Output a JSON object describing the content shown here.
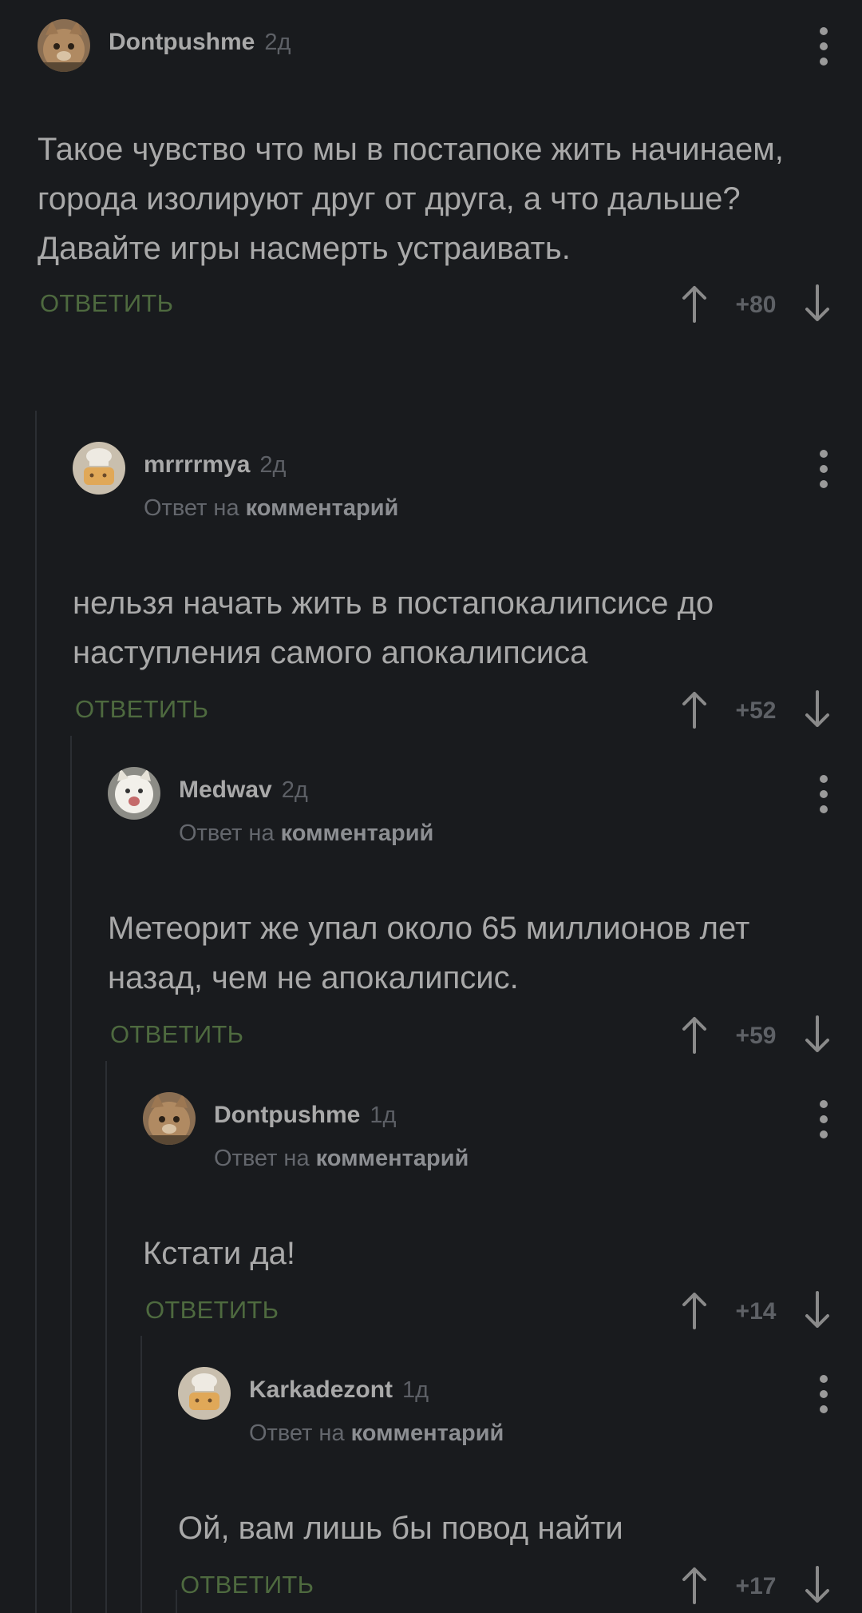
{
  "reply_to_prefix": "Ответ на",
  "reply_to_link": "комментарий",
  "reply_label": "ОТВЕТИТЬ",
  "comments": [
    {
      "author": "Dontpushme",
      "time": "2д",
      "text": "Такое чувство что мы в постапоке жить начинаем, города изолируют друг от друга, а что дальше? Давайте игры насмерть устраивать.",
      "score": "+80",
      "avatar": "cat-avatar"
    },
    {
      "author": "mrrrrmya",
      "time": "2д",
      "text": "нельзя начать жить в постапокалипсисе до наступления самого апокалипсиса",
      "score": "+52",
      "avatar": "chef-avatar"
    },
    {
      "author": "Medwav",
      "time": "2д",
      "text": "Метеорит же упал около 65 миллионов лет назад, чем не апокалипсис.",
      "score": "+59",
      "avatar": "white-cat-avatar"
    },
    {
      "author": "Dontpushme",
      "time": "1д",
      "text": "Кстати да!",
      "score": "+14",
      "avatar": "cat-avatar"
    },
    {
      "author": "Karkadezont",
      "time": "1д",
      "text": "Ой, вам лишь бы повод найти",
      "score": "+17",
      "avatar": "chef-avatar"
    }
  ],
  "colors": {
    "background": "#191b1e",
    "reply_button": "#4e6a3f",
    "thread_line": "#2b2e33"
  }
}
